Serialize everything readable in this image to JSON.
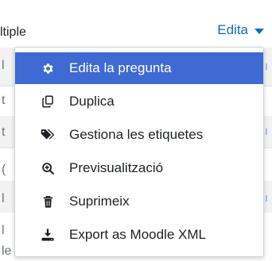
{
  "background": {
    "question_type_text": "ltiple",
    "edit_menu_label": "Edita",
    "left_edge_chars": [
      "l",
      "t",
      "t",
      "(",
      "l",
      "l",
      "le"
    ]
  },
  "menu": {
    "items": [
      {
        "label": "Edita la pregunta",
        "icon": "gear-icon",
        "active": true
      },
      {
        "label": "Duplica",
        "icon": "copy-icon",
        "active": false
      },
      {
        "label": "Gestiona les etiquetes",
        "icon": "tags-icon",
        "active": false
      },
      {
        "label": "Previsualització",
        "icon": "search-plus-icon",
        "active": false
      },
      {
        "label": "Suprimeix",
        "icon": "trash-icon",
        "active": false
      },
      {
        "label": "Export as Moodle XML",
        "icon": "download-icon",
        "active": false
      }
    ]
  },
  "colors": {
    "accent": "#0f6cbf",
    "active_item_bg": "#3f69d3",
    "active_item_text": "#ffffff",
    "text": "#1d2125"
  }
}
